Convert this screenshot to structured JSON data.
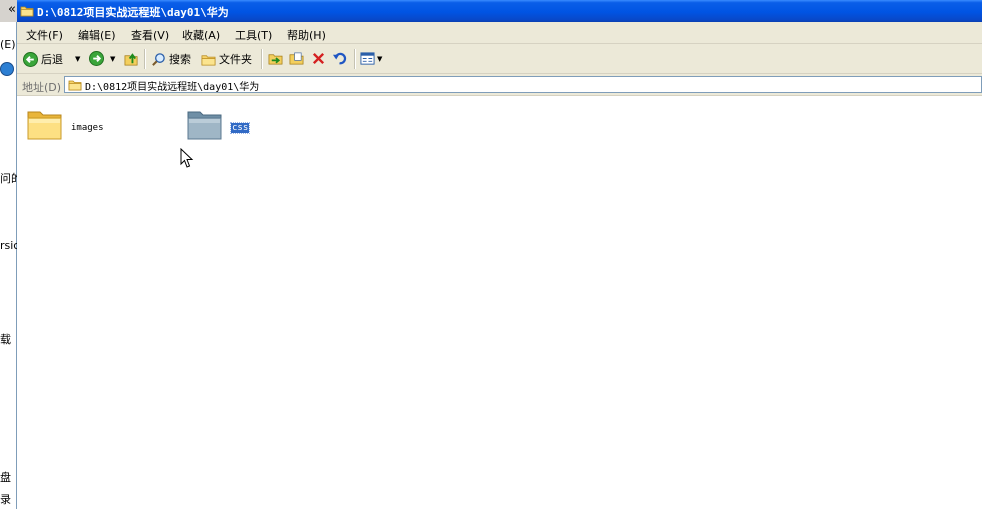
{
  "background_window": {
    "chevron": "«",
    "menu_fragment": "(E)",
    "text_fragments": [
      "问的",
      "rsic",
      "载",
      "盘",
      "录"
    ]
  },
  "window": {
    "title": "D:\\0812项目实战远程班\\day01\\华为"
  },
  "menu": [
    {
      "label": "文件(F)"
    },
    {
      "label": "编辑(E)"
    },
    {
      "label": "查看(V)"
    },
    {
      "label": "收藏(A)"
    },
    {
      "label": "工具(T)"
    },
    {
      "label": "帮助(H)"
    }
  ],
  "toolbar": {
    "back_label": "后退",
    "search_label": "搜索",
    "folders_label": "文件夹"
  },
  "address": {
    "label": "地址(D)",
    "value": "D:\\0812项目实战远程班\\day01\\华为"
  },
  "files": [
    {
      "name": "images",
      "selected": false
    },
    {
      "name": "css",
      "selected": true
    }
  ],
  "colors": {
    "titlebar": "#0054e3",
    "selection": "#316ac5"
  }
}
